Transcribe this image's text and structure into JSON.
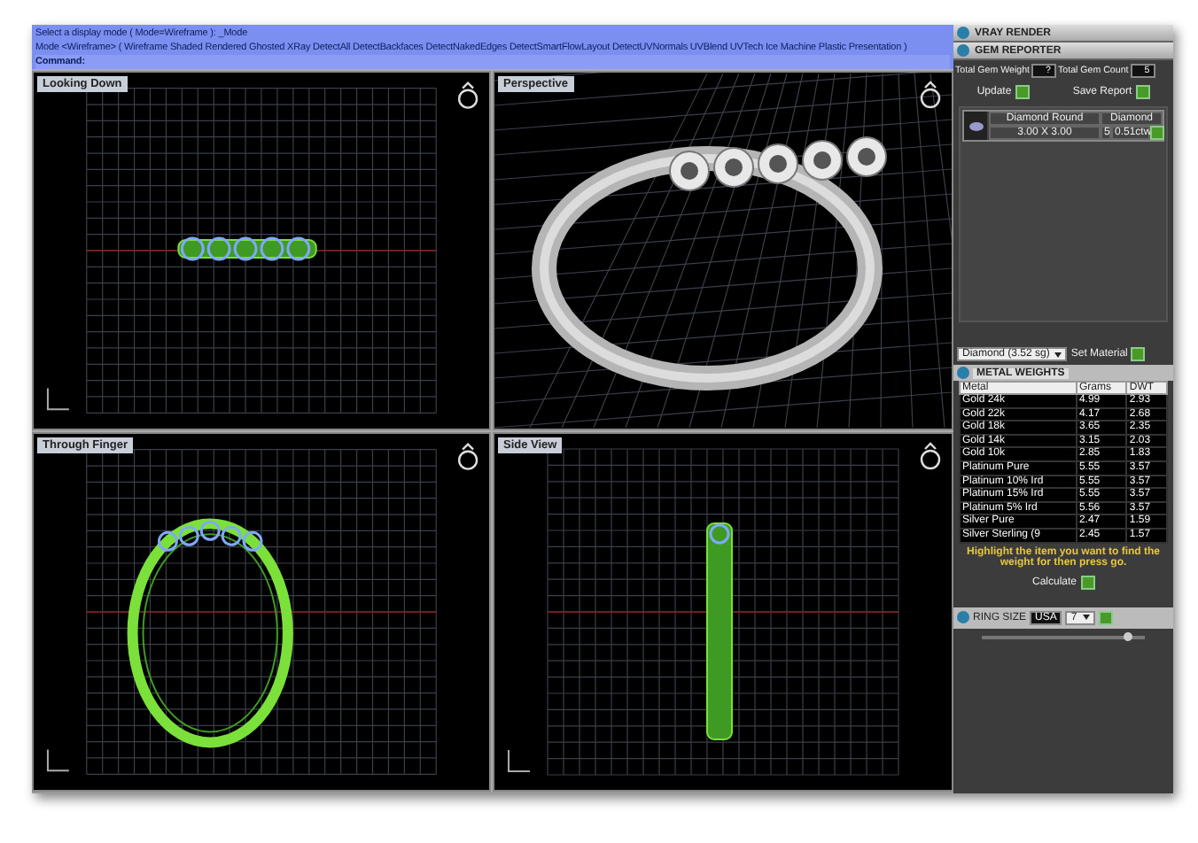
{
  "command": {
    "prompt": "Select a display mode ( Mode=Wireframe ): _Mode",
    "options": "Mode <Wireframe> ( Wireframe  Shaded  Rendered  Ghosted  XRay  DetectAll  DetectBackfaces  DetectNakedEdges  DetectSmartFlowLayout  DetectUVNormals  UVBlend  UVTech  Ice  Machine  Plastic  Presentation )",
    "label": "Command:"
  },
  "viewports": [
    {
      "title": "Looking Down",
      "kind": "top"
    },
    {
      "title": "Perspective",
      "kind": "perspective"
    },
    {
      "title": "Through Finger",
      "kind": "front"
    },
    {
      "title": "Side View",
      "kind": "side"
    }
  ],
  "side_panel": {
    "sections": [
      "VRAY RENDER",
      "GEM REPORTER"
    ],
    "gem_reporter": {
      "weight_label": "Total Gem Weight",
      "weight_value": "?",
      "count_label": "Total Gem Count",
      "count_value": "5",
      "update": "Update",
      "save": "Save Report",
      "gems": [
        {
          "shape": "Diamond Round",
          "size": "3.00 X 3.00",
          "material": "Diamond",
          "count": "5",
          "weight": "0.51ctw"
        }
      ],
      "material_select": "Diamond   (3.52 sg)",
      "set_material": "Set Material"
    },
    "metal_weights": {
      "tab": "METAL WEIGHTS",
      "columns": [
        "Metal",
        "Grams",
        "DWT"
      ],
      "rows": [
        [
          "Gold 24k",
          "4.99",
          "2.93"
        ],
        [
          "Gold 22k",
          "4.17",
          "2.68"
        ],
        [
          "Gold 18k",
          "3.65",
          "2.35"
        ],
        [
          "Gold 14k",
          "3.15",
          "2.03"
        ],
        [
          "Gold 10k",
          "2.85",
          "1.83"
        ],
        [
          "Platinum Pure",
          "5.55",
          "3.57"
        ],
        [
          "Platinum 10% Ird",
          "5.55",
          "3.57"
        ],
        [
          "Platinum 15% Ird",
          "5.55",
          "3.57"
        ],
        [
          "Platinum 5% Ird",
          "5.56",
          "3.57"
        ],
        [
          "Silver Pure",
          "2.47",
          "1.59"
        ],
        [
          "Silver Sterling (9",
          "2.45",
          "1.57"
        ]
      ],
      "hint": "Highlight the item you want to find the weight for then press go.",
      "calculate": "Calculate"
    },
    "ring_size": {
      "label": "RING SIZE",
      "system": "USA",
      "size": "7",
      "level": 0.9
    }
  }
}
